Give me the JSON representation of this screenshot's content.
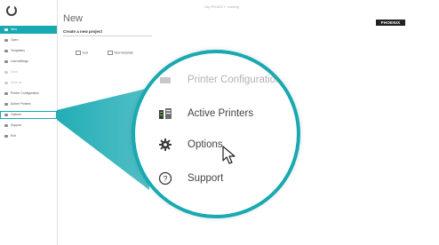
{
  "window": {
    "titlebar_text": "Clip PROJECT - marking"
  },
  "brand": {
    "name": "PHOENIX CONTACT"
  },
  "sidebar": {
    "items": [
      {
        "label": "New",
        "icon": "new-icon",
        "state": "active"
      },
      {
        "label": "Open",
        "icon": "open-icon",
        "state": "normal"
      },
      {
        "label": "Templates",
        "icon": "templates-icon",
        "state": "normal"
      },
      {
        "label": "Last settings",
        "icon": "last-settings-icon",
        "state": "normal"
      },
      {
        "label": "Save",
        "icon": "save-icon",
        "state": "disabled"
      },
      {
        "label": "Save as",
        "icon": "save-as-icon",
        "state": "disabled"
      },
      {
        "label": "Printer Configuration",
        "icon": "printer-config-icon",
        "state": "normal"
      },
      {
        "label": "Active Printers",
        "icon": "active-printers-icon",
        "state": "normal"
      },
      {
        "label": "Options",
        "icon": "gear-icon",
        "state": "selected"
      },
      {
        "label": "Support",
        "icon": "help-icon",
        "state": "normal"
      },
      {
        "label": "Exit",
        "icon": "exit-icon",
        "state": "normal"
      }
    ]
  },
  "main": {
    "title": "New",
    "subtitle": "Create a new project",
    "buttons": [
      {
        "label": "Just",
        "icon": "blank-project-icon"
      },
      {
        "label": "New template",
        "icon": "new-template-icon"
      }
    ]
  },
  "magnifier": {
    "items": [
      {
        "label": "Printer Configuration",
        "icon": "printer-config-icon"
      },
      {
        "label": "Active Printers",
        "icon": "active-printers-icon"
      },
      {
        "label": "Options",
        "icon": "gear-icon"
      },
      {
        "label": "Support",
        "icon": "help-icon"
      }
    ]
  },
  "colors": {
    "accent": "#18a9b2",
    "sidebar_border": "#e1e1e1",
    "text": "#444444"
  }
}
